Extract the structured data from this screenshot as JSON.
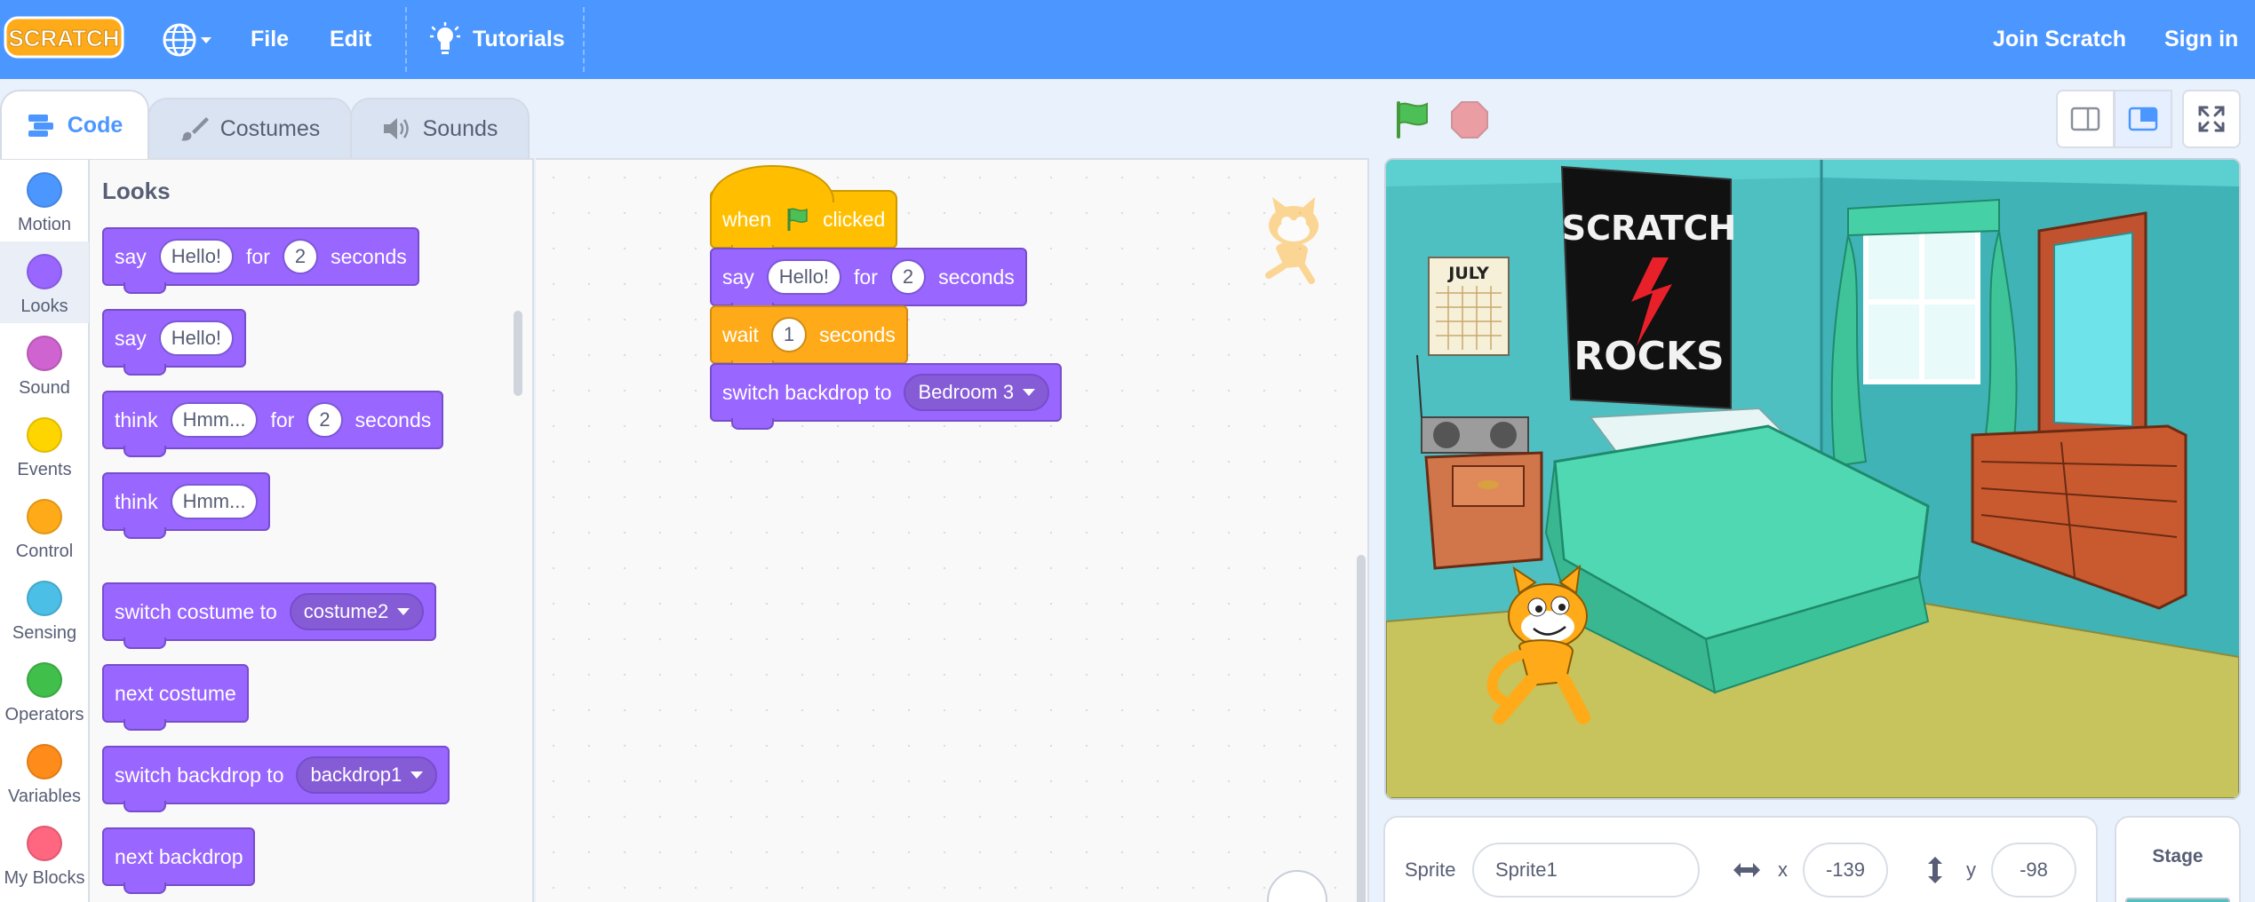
{
  "menubar": {
    "logo_text": "SCRATCH",
    "file": "File",
    "edit": "Edit",
    "tutorials": "Tutorials",
    "join": "Join Scratch",
    "signin": "Sign in"
  },
  "tabs": {
    "code": "Code",
    "costumes": "Costumes",
    "sounds": "Sounds"
  },
  "categories": [
    {
      "label": "Motion",
      "color": "#4c97ff"
    },
    {
      "label": "Looks",
      "color": "#9966ff"
    },
    {
      "label": "Sound",
      "color": "#cf63cf"
    },
    {
      "label": "Events",
      "color": "#ffd500"
    },
    {
      "label": "Control",
      "color": "#ffab19"
    },
    {
      "label": "Sensing",
      "color": "#4cbfe6"
    },
    {
      "label": "Operators",
      "color": "#40bf4a"
    },
    {
      "label": "Variables",
      "color": "#ff8c1a"
    },
    {
      "label": "My Blocks",
      "color": "#ff6680"
    }
  ],
  "palette": {
    "heading": "Looks",
    "say_for": {
      "say": "say",
      "msg": "Hello!",
      "for": "for",
      "secs": "2",
      "seconds": "seconds"
    },
    "say": {
      "say": "say",
      "msg": "Hello!"
    },
    "think_for": {
      "think": "think",
      "msg": "Hmm...",
      "for": "for",
      "secs": "2",
      "seconds": "seconds"
    },
    "think": {
      "think": "think",
      "msg": "Hmm..."
    },
    "switch_costume": {
      "label": "switch costume to",
      "value": "costume2"
    },
    "next_costume": "next costume",
    "switch_backdrop": {
      "label": "switch backdrop to",
      "value": "backdrop1"
    },
    "next_backdrop": "next backdrop"
  },
  "script": {
    "when": "when",
    "clicked": "clicked",
    "say": "say",
    "say_msg": "Hello!",
    "for": "for",
    "say_secs": "2",
    "seconds": "seconds",
    "wait": "wait",
    "wait_secs": "1",
    "wait_seconds": "seconds",
    "switch_backdrop": "switch backdrop to",
    "backdrop_value": "Bedroom 3"
  },
  "stage": {
    "poster_line1": "SCRATCH",
    "poster_line2": "ROCKS",
    "calendar": "JULY"
  },
  "sprite_info": {
    "sprite_label": "Sprite",
    "sprite_name": "Sprite1",
    "x_label": "x",
    "x_value": "-139",
    "y_label": "y",
    "y_value": "-98"
  },
  "stage_panel": {
    "label": "Stage"
  },
  "colors": {
    "menubar": "#4c97ff",
    "looks": "#9966ff",
    "events": "#ffbf00",
    "control": "#ffab19"
  }
}
